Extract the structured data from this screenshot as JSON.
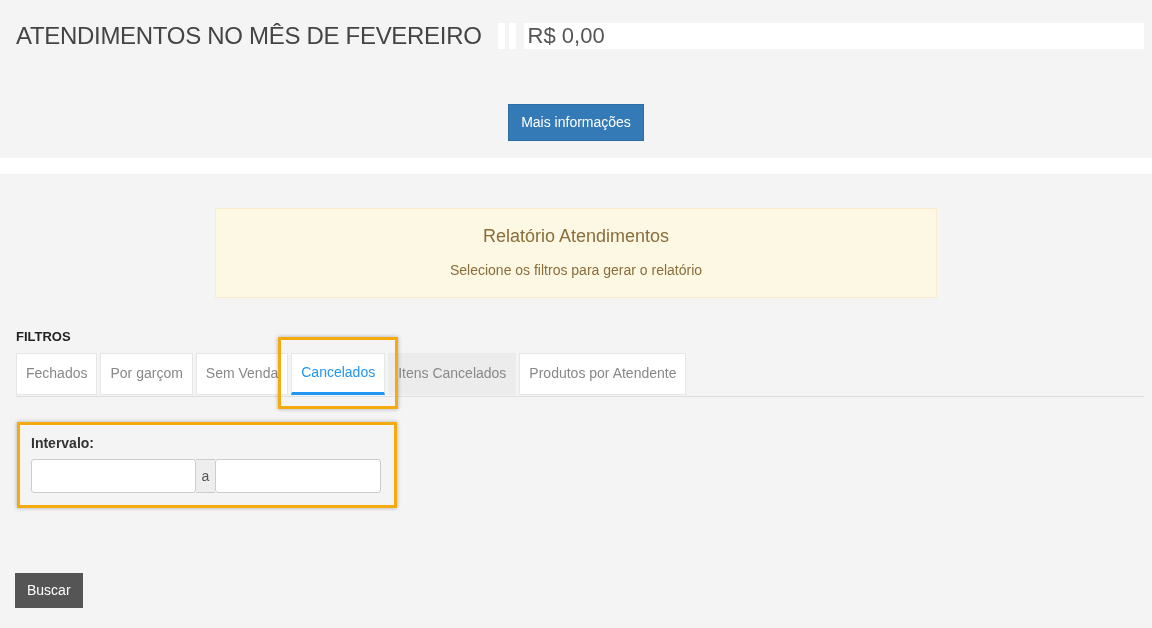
{
  "header": {
    "title": "ATENDIMENTOS NO MÊS DE FEVEREIRO",
    "amount": "R$ 0,00",
    "button": "Mais informações"
  },
  "report": {
    "title": "Relatório Atendimentos",
    "message": "Selecione os filtros para gerar o relatório"
  },
  "filters": {
    "heading": "FILTROS",
    "tabs": [
      {
        "label": "Fechados",
        "selected": false,
        "hovered": false
      },
      {
        "label": "Por garçom",
        "selected": false,
        "hovered": false
      },
      {
        "label": "Sem Venda",
        "selected": false,
        "hovered": false
      },
      {
        "label": "Cancelados",
        "selected": true,
        "hovered": false
      },
      {
        "label": "Itens Cancelados",
        "selected": false,
        "hovered": true
      },
      {
        "label": "Produtos por Atendente",
        "selected": false,
        "hovered": false
      }
    ],
    "interval": {
      "label": "Intervalo:",
      "separator": "a"
    }
  },
  "search_button": "Buscar"
}
